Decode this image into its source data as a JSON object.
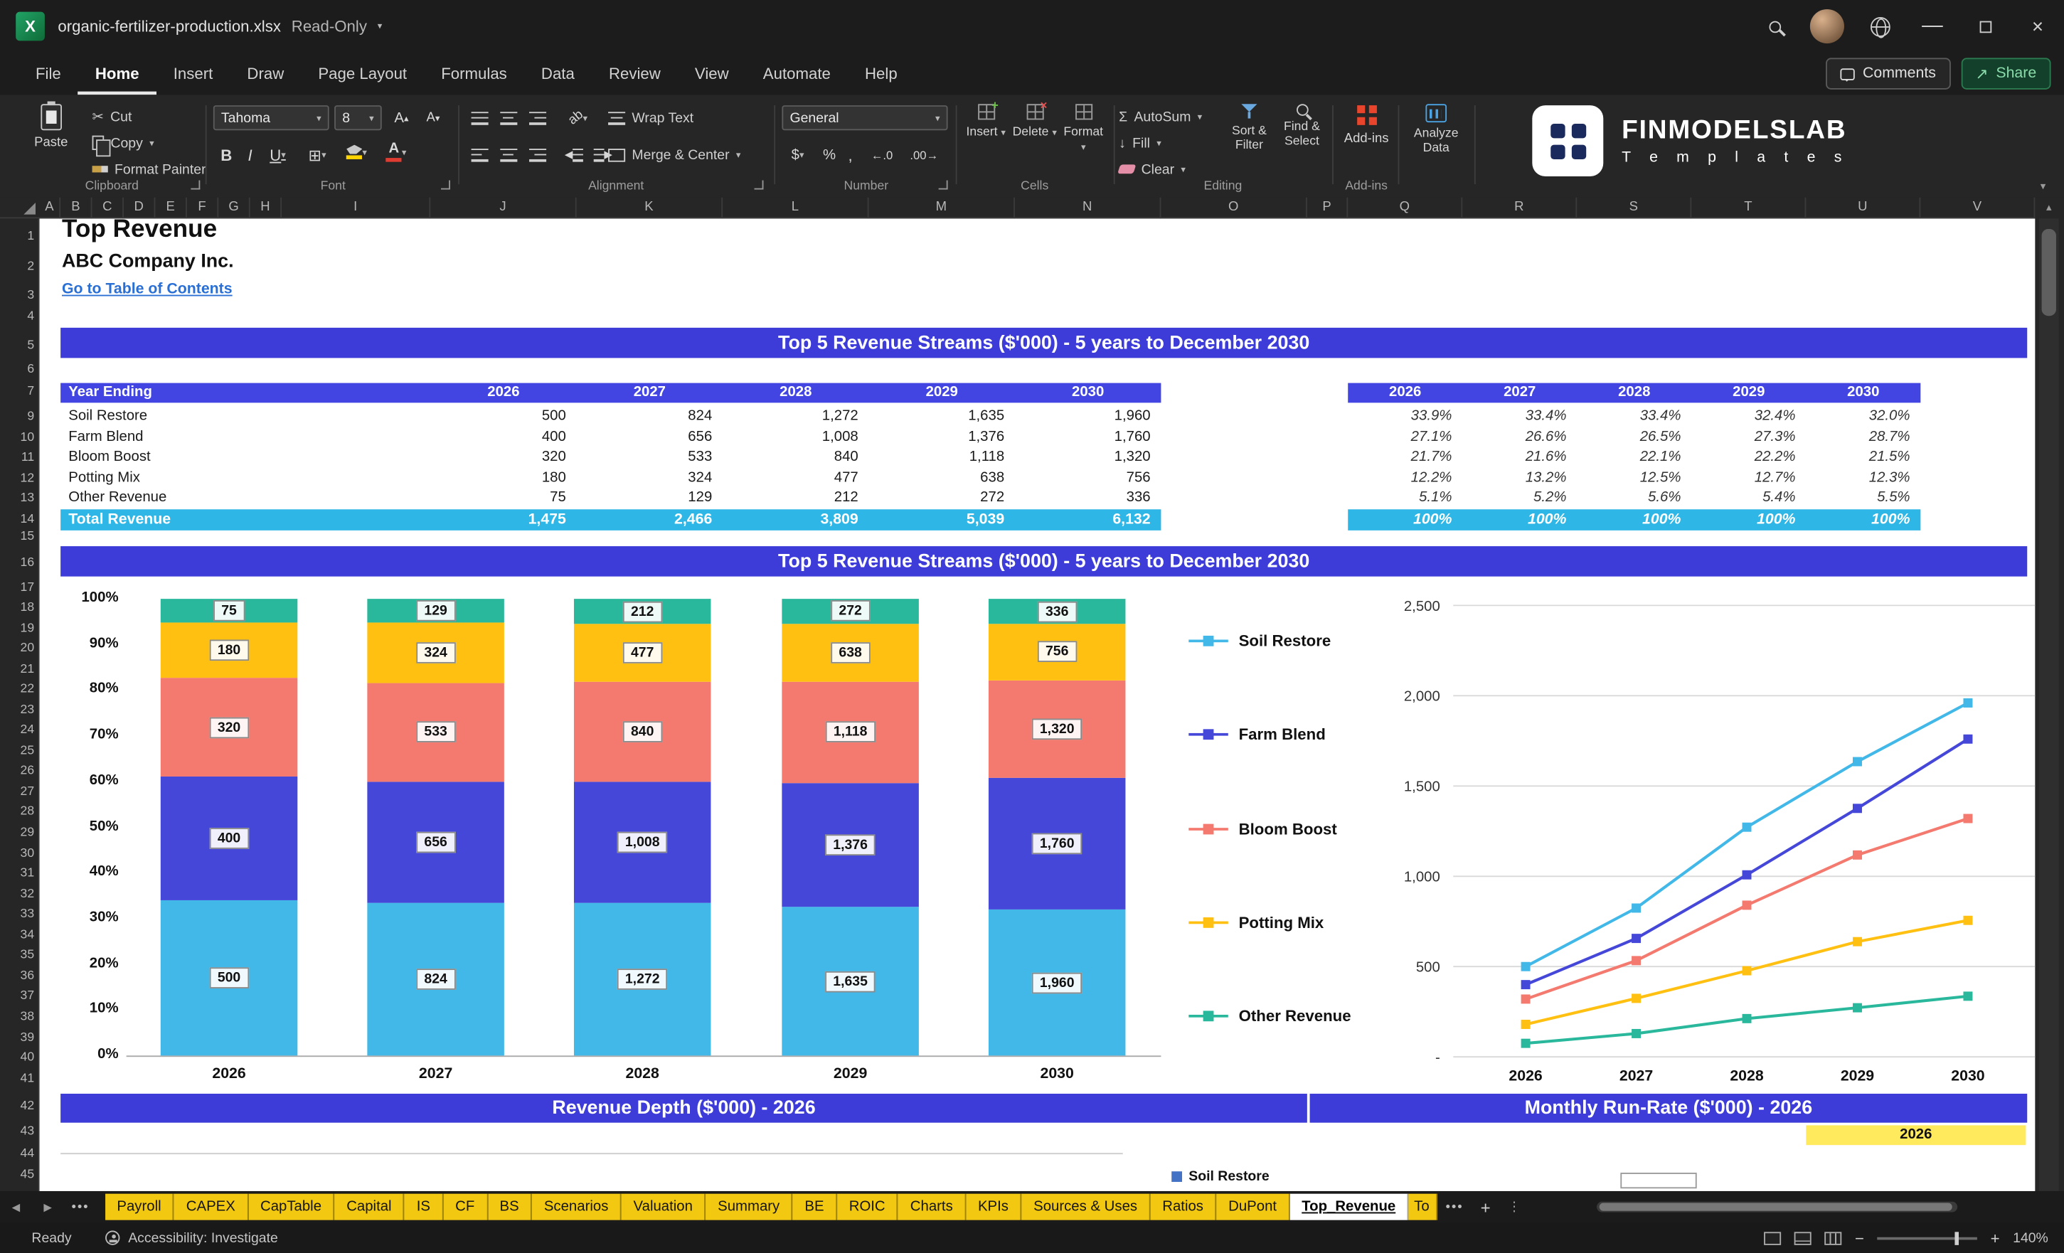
{
  "window": {
    "filename": "organic-fertilizer-production.xlsx",
    "mode": "Read-Only"
  },
  "menubar": {
    "tabs": [
      "File",
      "Home",
      "Insert",
      "Draw",
      "Page Layout",
      "Formulas",
      "Data",
      "Review",
      "View",
      "Automate",
      "Help"
    ],
    "active": "Home",
    "comments_label": "Comments",
    "share_label": "Share"
  },
  "icons": {
    "cut": "✂",
    "sigma": "Σ",
    "fill_down": "↓",
    "bold": "B",
    "italic": "I",
    "underline": "U",
    "dollar": "$",
    "percent": "%",
    "comma": ",",
    "increase_decimal": "←.0",
    "decrease_decimal": ".00→",
    "letter_a": "A",
    "borders": "⊞",
    "orientation": "ab"
  },
  "ribbon": {
    "paste": "Paste",
    "cut": "Cut",
    "copy": "Copy",
    "format_painter": "Format Painter",
    "clipboard_group": "Clipboard",
    "font_name": "Tahoma",
    "font_size": "8",
    "font_group": "Font",
    "wrap_text": "Wrap Text",
    "merge_center": "Merge & Center",
    "alignment_group": "Alignment",
    "number_format": "General",
    "number_group": "Number",
    "insert": "Insert",
    "delete": "Delete",
    "format": "Format",
    "cells_group": "Cells",
    "autosum": "AutoSum",
    "fill": "Fill",
    "clear": "Clear",
    "sort_filter": "Sort & Filter",
    "find_select": "Find & Select",
    "editing_group": "Editing",
    "addins": "Add-ins",
    "addins_group": "Add-ins",
    "analyze_data": "Analyze Data",
    "brand_name": "FINMODELSLAB",
    "brand_tagline": "T e m p l a t e s"
  },
  "grid": {
    "columns": [
      "A",
      "B",
      "C",
      "D",
      "E",
      "F",
      "G",
      "H",
      "I",
      "J",
      "K",
      "L",
      "M",
      "N",
      "O",
      "P",
      "Q",
      "R",
      "S",
      "T",
      "U",
      "V"
    ],
    "rows": [
      "1",
      "2",
      "3",
      "4",
      "5",
      "6",
      "7",
      "9",
      "10",
      "11",
      "12",
      "13",
      "14",
      "15",
      "16",
      "17",
      "18",
      "19",
      "20",
      "21",
      "22",
      "23",
      "24",
      "25",
      "26",
      "27",
      "28",
      "29",
      "30",
      "31",
      "32",
      "33",
      "34",
      "35",
      "36",
      "37",
      "38",
      "39",
      "40",
      "41",
      "42",
      "43",
      "44",
      "45"
    ]
  },
  "colors": {
    "banner": "#3d3cd8",
    "thead": "#4245e2",
    "total": "#2eb6e6",
    "highlight": "#ffe95c",
    "tab": "#f2c811",
    "link": "#2a6fd4"
  },
  "sheet": {
    "title": "Top Revenue",
    "company": "ABC Company Inc.",
    "toc_link": "Go to Table of Contents",
    "banner_top": "Top 5 Revenue Streams ($'000) - 5 years to December 2030",
    "banner_chart": "Top 5 Revenue Streams ($'000) - 5 years to December 2030",
    "banner_depth": "Revenue Depth ($'000) - 2026",
    "banner_runrate": "Monthly Run-Rate ($'000) - 2026",
    "year_cell": "2026",
    "runrate_legend": "Soil Restore",
    "table": {
      "row_header": "Year Ending",
      "years": [
        "2026",
        "2027",
        "2028",
        "2029",
        "2030"
      ],
      "rows": [
        {
          "label": "Soil Restore",
          "values": [
            "500",
            "824",
            "1,272",
            "1,635",
            "1,960"
          ],
          "pcts": [
            "33.9%",
            "33.4%",
            "33.4%",
            "32.4%",
            "32.0%"
          ]
        },
        {
          "label": "Farm Blend",
          "values": [
            "400",
            "656",
            "1,008",
            "1,376",
            "1,760"
          ],
          "pcts": [
            "27.1%",
            "26.6%",
            "26.5%",
            "27.3%",
            "28.7%"
          ]
        },
        {
          "label": "Bloom Boost",
          "values": [
            "320",
            "533",
            "840",
            "1,118",
            "1,320"
          ],
          "pcts": [
            "21.7%",
            "21.6%",
            "22.1%",
            "22.2%",
            "21.5%"
          ]
        },
        {
          "label": "Potting Mix",
          "values": [
            "180",
            "324",
            "477",
            "638",
            "756"
          ],
          "pcts": [
            "12.2%",
            "13.2%",
            "12.5%",
            "12.7%",
            "12.3%"
          ]
        },
        {
          "label": "Other Revenue",
          "values": [
            "75",
            "129",
            "212",
            "272",
            "336"
          ],
          "pcts": [
            "5.1%",
            "5.2%",
            "5.6%",
            "5.4%",
            "5.5%"
          ]
        }
      ],
      "total": {
        "label": "Total Revenue",
        "values": [
          "1,475",
          "2,466",
          "3,809",
          "5,039",
          "6,132"
        ],
        "pcts": [
          "100%",
          "100%",
          "100%",
          "100%",
          "100%"
        ]
      }
    }
  },
  "chart_data": [
    {
      "type": "bar",
      "stacked": true,
      "percent": true,
      "title": "Top 5 Revenue Streams ($'000) - 5 years to December 2030",
      "categories": [
        "2026",
        "2027",
        "2028",
        "2029",
        "2030"
      ],
      "series": [
        {
          "name": "Soil Restore",
          "color": "#41b8e8",
          "values": [
            500,
            824,
            1272,
            1635,
            1960
          ],
          "labels": [
            "500",
            "824",
            "1,272",
            "1,635",
            "1,960"
          ]
        },
        {
          "name": "Farm Blend",
          "color": "#4547d8",
          "values": [
            400,
            656,
            1008,
            1376,
            1760
          ],
          "labels": [
            "400",
            "656",
            "1,008",
            "1,376",
            "1,760"
          ]
        },
        {
          "name": "Bloom Boost",
          "color": "#f4796e",
          "values": [
            320,
            533,
            840,
            1118,
            1320
          ],
          "labels": [
            "320",
            "533",
            "840",
            "1,118",
            "1,320"
          ]
        },
        {
          "name": "Potting Mix",
          "color": "#ffc011",
          "values": [
            180,
            324,
            477,
            638,
            756
          ],
          "labels": [
            "180",
            "324",
            "477",
            "638",
            "756"
          ]
        },
        {
          "name": "Other Revenue",
          "color": "#2ab89c",
          "values": [
            75,
            129,
            212,
            272,
            336
          ],
          "labels": [
            "75",
            "129",
            "212",
            "272",
            "336"
          ]
        }
      ],
      "y_ticks": [
        "100%",
        "90%",
        "80%",
        "70%",
        "60%",
        "50%",
        "40%",
        "30%",
        "20%",
        "10%",
        "0%"
      ],
      "legend_position": "right",
      "grid": false
    },
    {
      "type": "line",
      "categories": [
        "2026",
        "2027",
        "2028",
        "2029",
        "2030"
      ],
      "series": [
        {
          "name": "Soil Restore",
          "color": "#41b8e8",
          "values": [
            500,
            824,
            1272,
            1635,
            1960
          ]
        },
        {
          "name": "Farm Blend",
          "color": "#4547d8",
          "values": [
            400,
            656,
            1008,
            1376,
            1760
          ]
        },
        {
          "name": "Bloom Boost",
          "color": "#f4796e",
          "values": [
            320,
            533,
            840,
            1118,
            1320
          ]
        },
        {
          "name": "Potting Mix",
          "color": "#ffc011",
          "values": [
            180,
            324,
            477,
            638,
            756
          ]
        },
        {
          "name": "Other Revenue",
          "color": "#2ab89c",
          "values": [
            75,
            129,
            212,
            272,
            336
          ]
        }
      ],
      "y_ticks": [
        "2,500",
        "2,000",
        "1,500",
        "1,000",
        "500",
        "-"
      ],
      "ylim": [
        0,
        2500
      ],
      "grid": true
    }
  ],
  "tabbar": {
    "tabs": [
      "Payroll",
      "CAPEX",
      "CapTable",
      "Capital",
      "IS",
      "CF",
      "BS",
      "Scenarios",
      "Valuation",
      "Summary",
      "BE",
      "ROIC",
      "Charts",
      "KPIs",
      "Sources & Uses",
      "Ratios",
      "DuPont",
      "Top_Revenue"
    ],
    "active": "Top_Revenue",
    "partial_tab": "To"
  },
  "statusbar": {
    "ready": "Ready",
    "accessibility": "Accessibility: Investigate",
    "zoom": "140%"
  }
}
